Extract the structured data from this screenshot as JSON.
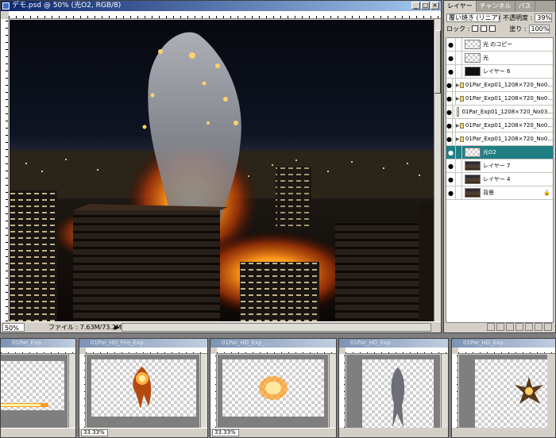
{
  "main_window": {
    "title": "デモ.psd @ 50% (光O2, RGB/8)",
    "minimize": "_",
    "maximize": "□",
    "close": "×",
    "zoom": "50%",
    "file_info": "ファイル : 7.63M/73.2M",
    "status_arrow": "▶"
  },
  "layers_palette": {
    "tabs": [
      "レイヤー",
      "チャンネル",
      "パス"
    ],
    "blend_mode": "覆い焼き (リニア)",
    "opacity_label": "不透明度 :",
    "opacity_value": "39%",
    "lock_label": "ロック :",
    "fill_label": "塗り :",
    "fill_value": "100%",
    "layers": [
      {
        "name": "光 のコピー",
        "type": "layer",
        "thumb": "checker",
        "selected": false
      },
      {
        "name": "光",
        "type": "layer",
        "thumb": "checker",
        "selected": false
      },
      {
        "name": "レイヤー 6",
        "type": "layer",
        "thumb": "black",
        "selected": false
      },
      {
        "name": "01Par_Exp01_1208×720_No0...",
        "type": "group",
        "thumb": "none",
        "selected": false
      },
      {
        "name": "01Par_Exp01_1208×720_No0...",
        "type": "group",
        "thumb": "none",
        "selected": false
      },
      {
        "name": "01Par_Exp01_1208×720_No03...",
        "type": "layer",
        "thumb": "checker",
        "selected": false
      },
      {
        "name": "01Par_Exp01_1208×720_No0...",
        "type": "group",
        "thumb": "none",
        "selected": false
      },
      {
        "name": "01Par_Exp01_1208×720_No0...",
        "type": "group",
        "thumb": "none",
        "selected": false
      },
      {
        "name": "光O2",
        "type": "layer",
        "thumb": "checker",
        "selected": true
      },
      {
        "name": "レイヤー 7",
        "type": "layer",
        "thumb": "dark",
        "selected": false
      },
      {
        "name": "レイヤー 4",
        "type": "layer",
        "thumb": "dark",
        "selected": false
      },
      {
        "name": "背景",
        "type": "layer",
        "thumb": "dark",
        "selected": false,
        "locked": true
      }
    ]
  },
  "sub_windows": [
    {
      "title": "01Par_Exp...",
      "zoom": ""
    },
    {
      "title": "01Par_HD_Fire_Exp...",
      "zoom": "33.33%"
    },
    {
      "title": "01Par_HD_Exp_...",
      "zoom": "33.33%"
    },
    {
      "title": "01Par_HD_Exp...",
      "zoom": ""
    },
    {
      "title": "01Par_HD_Exp...",
      "zoom": ""
    }
  ]
}
